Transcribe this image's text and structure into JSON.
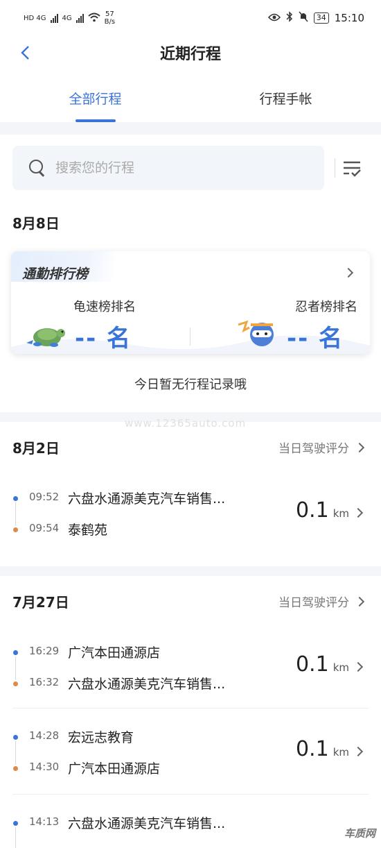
{
  "status_bar": {
    "net_speed_value": "57",
    "net_speed_unit": "B/s",
    "battery": "34",
    "time": "15:10"
  },
  "header": {
    "title": "近期行程"
  },
  "tabs": [
    {
      "label": "全部行程",
      "active": true
    },
    {
      "label": "行程手帐",
      "active": false
    }
  ],
  "search": {
    "placeholder": "搜索您的行程"
  },
  "days": [
    {
      "date": "8月8日",
      "ranking": {
        "title": "通勤排行榜",
        "left_label": "龟速榜排名",
        "left_value": "-- 名",
        "right_label": "忍者榜排名",
        "right_value": "-- 名"
      },
      "empty_text": "今日暂无行程记录哦"
    },
    {
      "date": "8月2日",
      "score_link": "当日驾驶评分",
      "trips": [
        {
          "start_time": "09:52",
          "start_place": "六盘水通源美克汽车销售...",
          "end_time": "09:54",
          "end_place": "泰鹤苑",
          "distance": "0.1",
          "unit": "km"
        }
      ]
    },
    {
      "date": "7月27日",
      "score_link": "当日驾驶评分",
      "trips": [
        {
          "start_time": "16:29",
          "start_place": "广汽本田通源店",
          "end_time": "16:32",
          "end_place": "六盘水通源美克汽车销售...",
          "distance": "0.1",
          "unit": "km"
        },
        {
          "start_time": "14:28",
          "start_place": "宏远志教育",
          "end_time": "14:30",
          "end_place": "广汽本田通源店",
          "distance": "0.1",
          "unit": "km"
        },
        {
          "start_time": "14:13",
          "start_place": "六盘水通源美克汽车销售...",
          "end_time": "",
          "end_place": "",
          "distance": "",
          "unit": ""
        }
      ]
    }
  ],
  "watermark": "www.12365auto.com",
  "corner_logo": "车质网",
  "colors": {
    "accent": "#3a74d8",
    "start_dot": "#3a74d8",
    "end_dot": "#e08a4a"
  }
}
